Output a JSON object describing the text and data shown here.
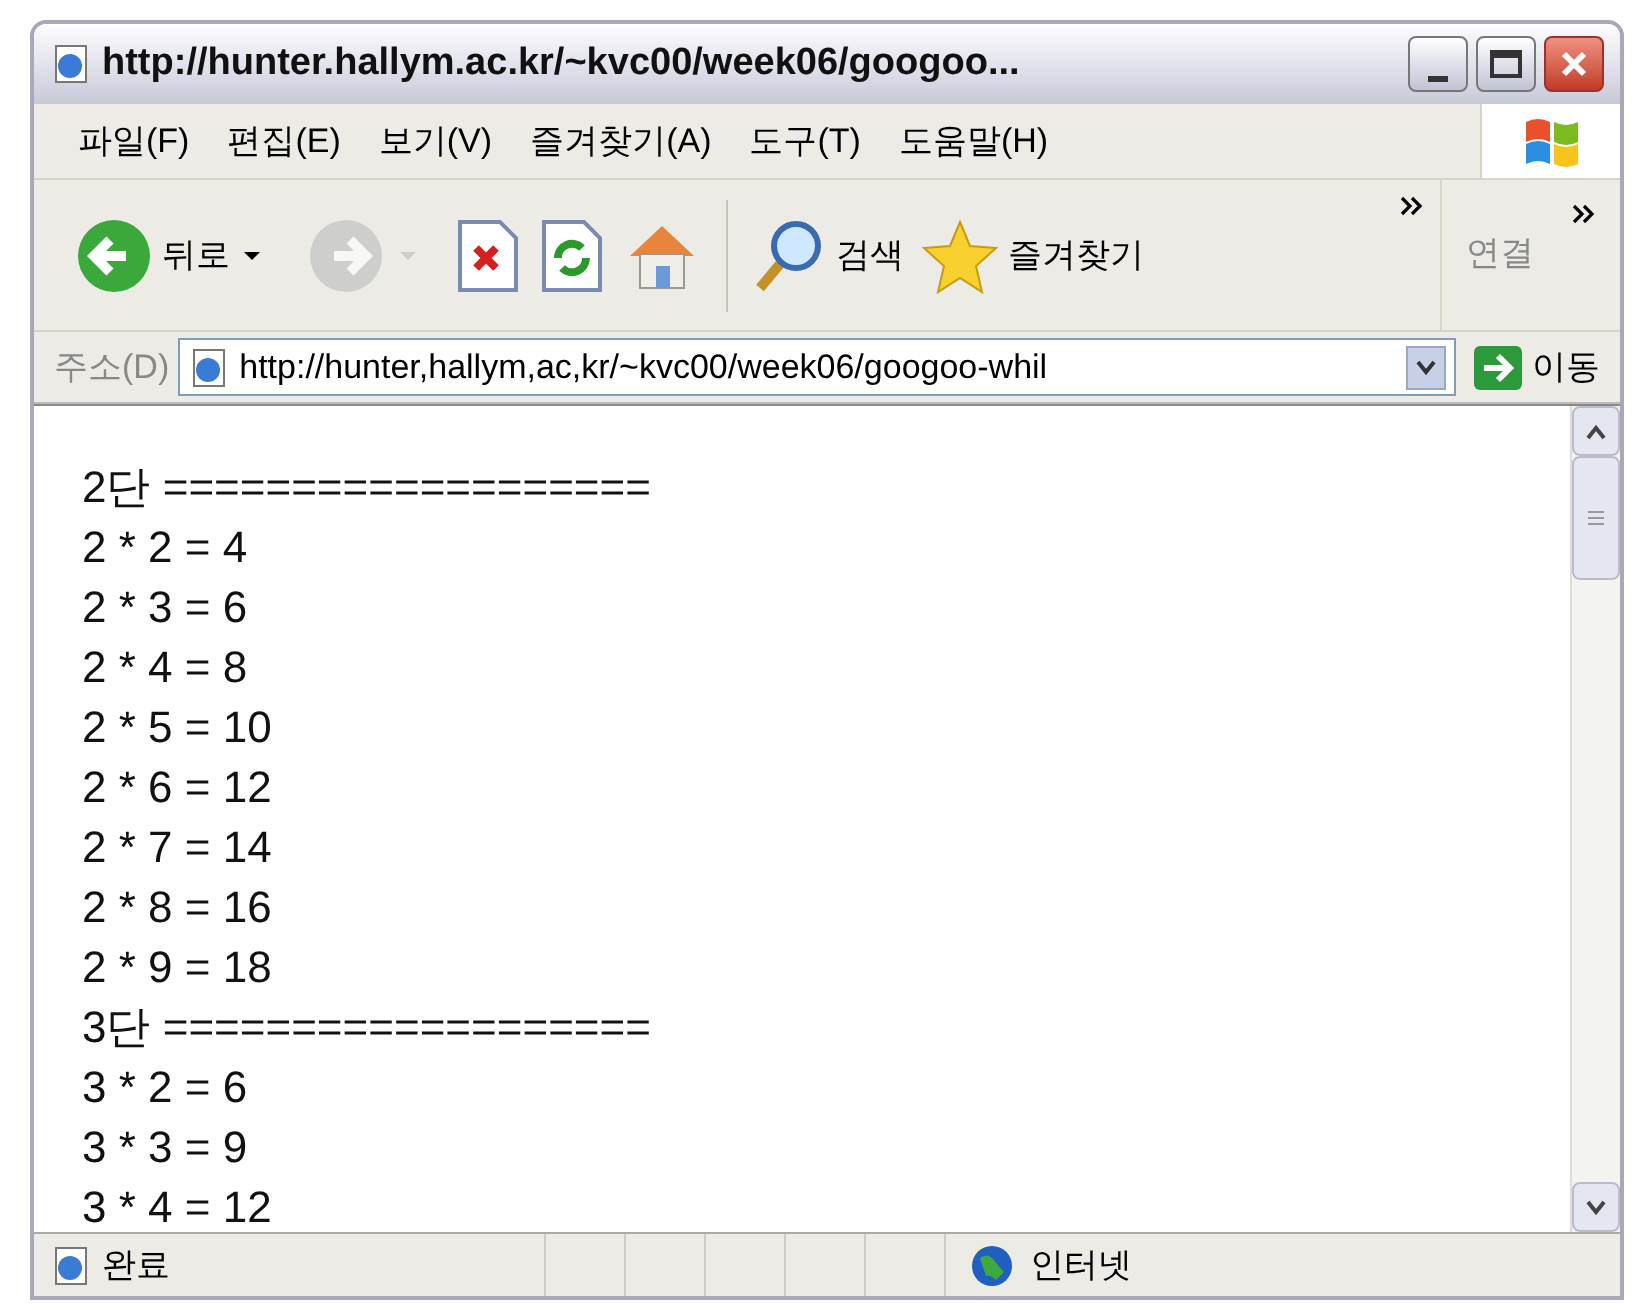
{
  "window": {
    "title": "http://hunter.hallym.ac.kr/~kvc00/week06/googoo..."
  },
  "menu": [
    {
      "label": "파일(F)"
    },
    {
      "label": "편집(E)"
    },
    {
      "label": "보기(V)"
    },
    {
      "label": "즐겨찾기(A)"
    },
    {
      "label": "도구(T)"
    },
    {
      "label": "도움말(H)"
    }
  ],
  "toolbar": {
    "buttons": [
      {
        "kind": "back",
        "label": "뒤로",
        "disabled": false
      },
      {
        "kind": "forward",
        "disabled": true
      },
      {
        "kind": "stop",
        "disabled": false
      },
      {
        "kind": "refresh",
        "disabled": false
      },
      {
        "kind": "home",
        "disabled": false
      },
      {
        "kind": "search",
        "label": "검색",
        "disabled": false
      },
      {
        "kind": "favorites",
        "label": "즐겨찾기",
        "disabled": false
      }
    ],
    "links_label": "연결"
  },
  "address_bar": {
    "label": "주소(D)",
    "value": "http://hunter,hallym,ac,kr/~kvc00/week06/googoo-whil",
    "go_label": "이동"
  },
  "content": {
    "lines": [
      "2단 ===================",
      "2 * 2 = 4",
      "2 * 3 = 6",
      "2 * 4 = 8",
      "2 * 5 = 10",
      "2 * 6 = 12",
      "2 * 7 = 14",
      "2 * 8 = 16",
      "2 * 9 = 18",
      "3단 ===================",
      "3 * 2 = 6",
      "3 * 3 = 9",
      "3 * 4 = 12"
    ]
  },
  "status_bar": {
    "text": "완료",
    "zone": "인터넷"
  }
}
